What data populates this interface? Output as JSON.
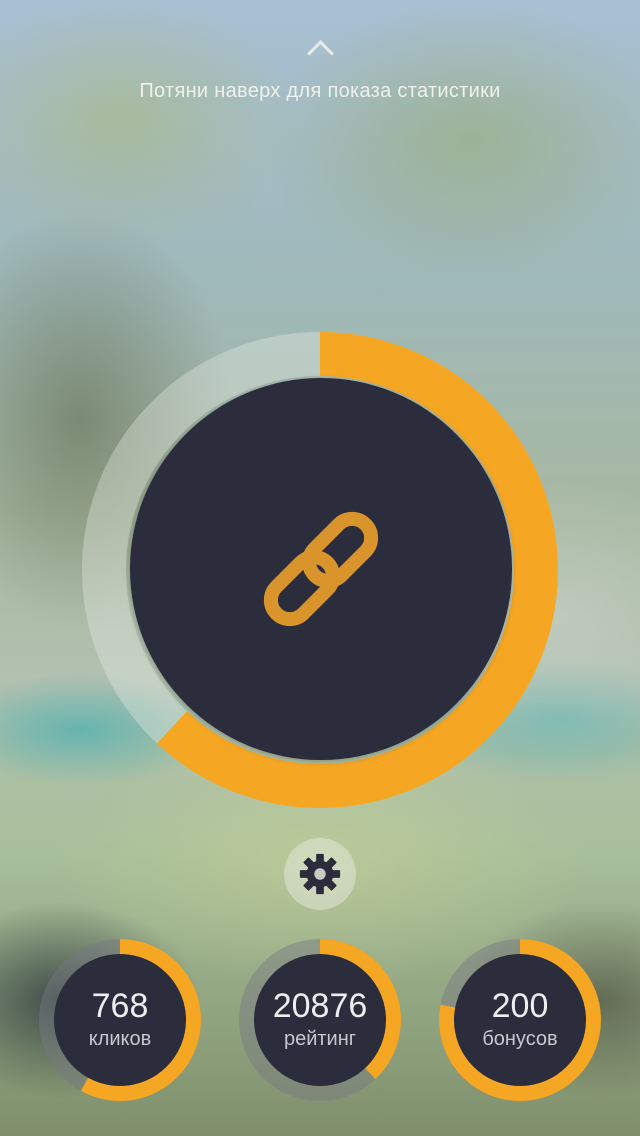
{
  "pull_hint": {
    "icon": "chevron-up-icon",
    "text": "Потяни наверх для показа статистики"
  },
  "main": {
    "icon": "link-icon",
    "progress": 0.62
  },
  "settings": {
    "icon": "gear-icon"
  },
  "stats": [
    {
      "value": "768",
      "label": "кликов",
      "progress": 0.58
    },
    {
      "value": "20876",
      "label": "рейтинг",
      "progress": 0.38
    },
    {
      "value": "200",
      "label": "бонусов",
      "progress": 0.78
    }
  ],
  "colors": {
    "accent": "#f5a623",
    "dark": "#2b2c3c",
    "icon_gold": "#d9952b"
  }
}
